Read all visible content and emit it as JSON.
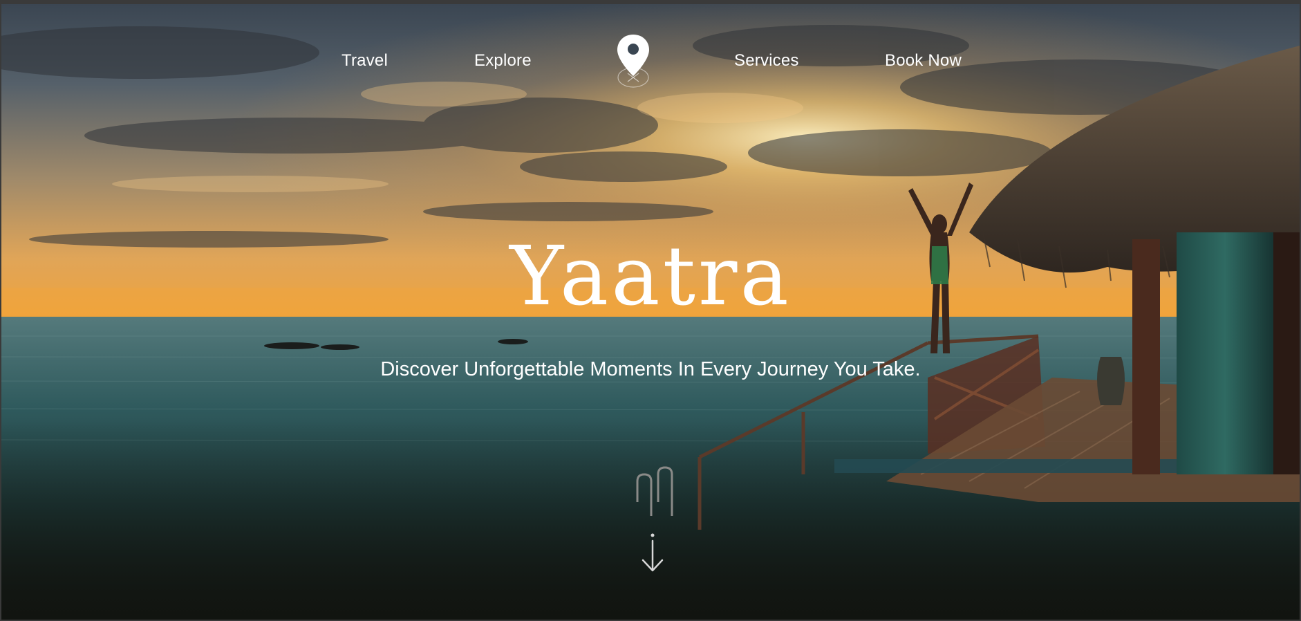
{
  "nav": {
    "items": [
      {
        "label": "Travel"
      },
      {
        "label": "Explore"
      },
      {
        "label": "Services"
      },
      {
        "label": "Book Now"
      }
    ],
    "logo_icon": "map-pin-icon"
  },
  "hero": {
    "title": "Yaatra",
    "tagline": "Discover Unforgettable Moments In Every Journey You Take.",
    "background": "sunset-ocean-overwater-bungalow",
    "scroll_icon": "arrow-down-icon"
  },
  "colors": {
    "text": "#ffffff",
    "sky_top": "#3a4a5a",
    "sunset": "#f2a640",
    "ocean": "#2e5558",
    "bottom": "#151813"
  }
}
